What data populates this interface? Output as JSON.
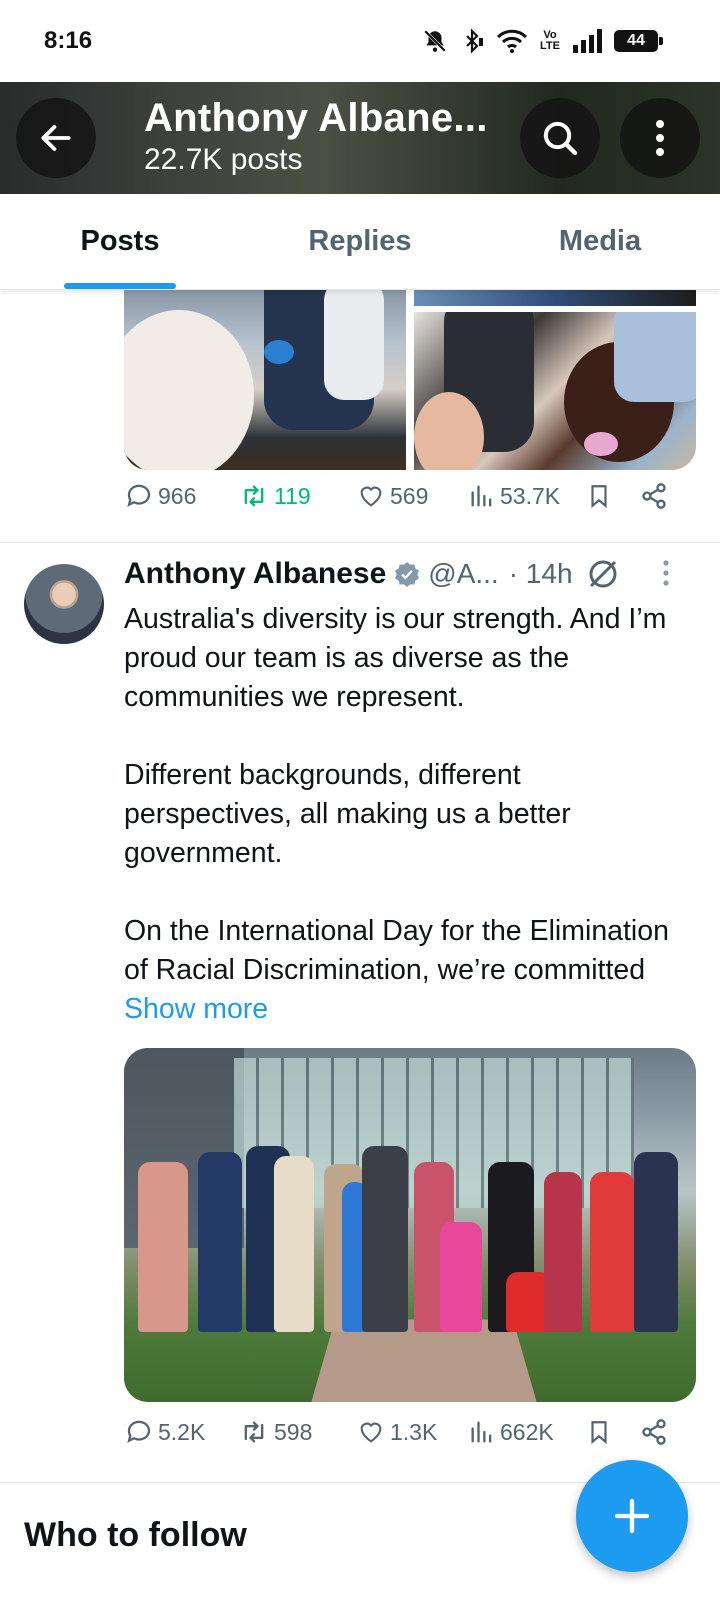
{
  "status_bar": {
    "time": "8:16",
    "volte_top": "Vo",
    "volte_bottom": "LTE",
    "battery": "44"
  },
  "header": {
    "title": "Anthony Albane...",
    "subtitle": "22.7K posts"
  },
  "tabs": [
    {
      "label": "Posts",
      "active": true
    },
    {
      "label": "Replies",
      "active": false
    },
    {
      "label": "Media",
      "active": false
    }
  ],
  "post1": {
    "stats": {
      "replies": "966",
      "reposts": "119",
      "likes": "569",
      "views": "53.7K"
    }
  },
  "post2": {
    "author": "Anthony Albanese",
    "handle": "@A...",
    "time": "· 14h",
    "paragraphs": [
      "Australia's diversity is our strength. And I’m proud our team is as diverse as the communities we represent.",
      "Different backgrounds, different perspectives, all making us a better government."
    ],
    "last_paragraph": "On the International Day for the Elimination of Racial Discrimination, we’re committed",
    "show_more": "Show more",
    "stats": {
      "replies": "5.2K",
      "reposts": "598",
      "likes": "1.3K",
      "views": "662K"
    }
  },
  "who_to_follow": "Who to follow",
  "colors": {
    "accent": "#1d9bf0",
    "repost_green": "#00ba7c",
    "muted": "#536471"
  }
}
